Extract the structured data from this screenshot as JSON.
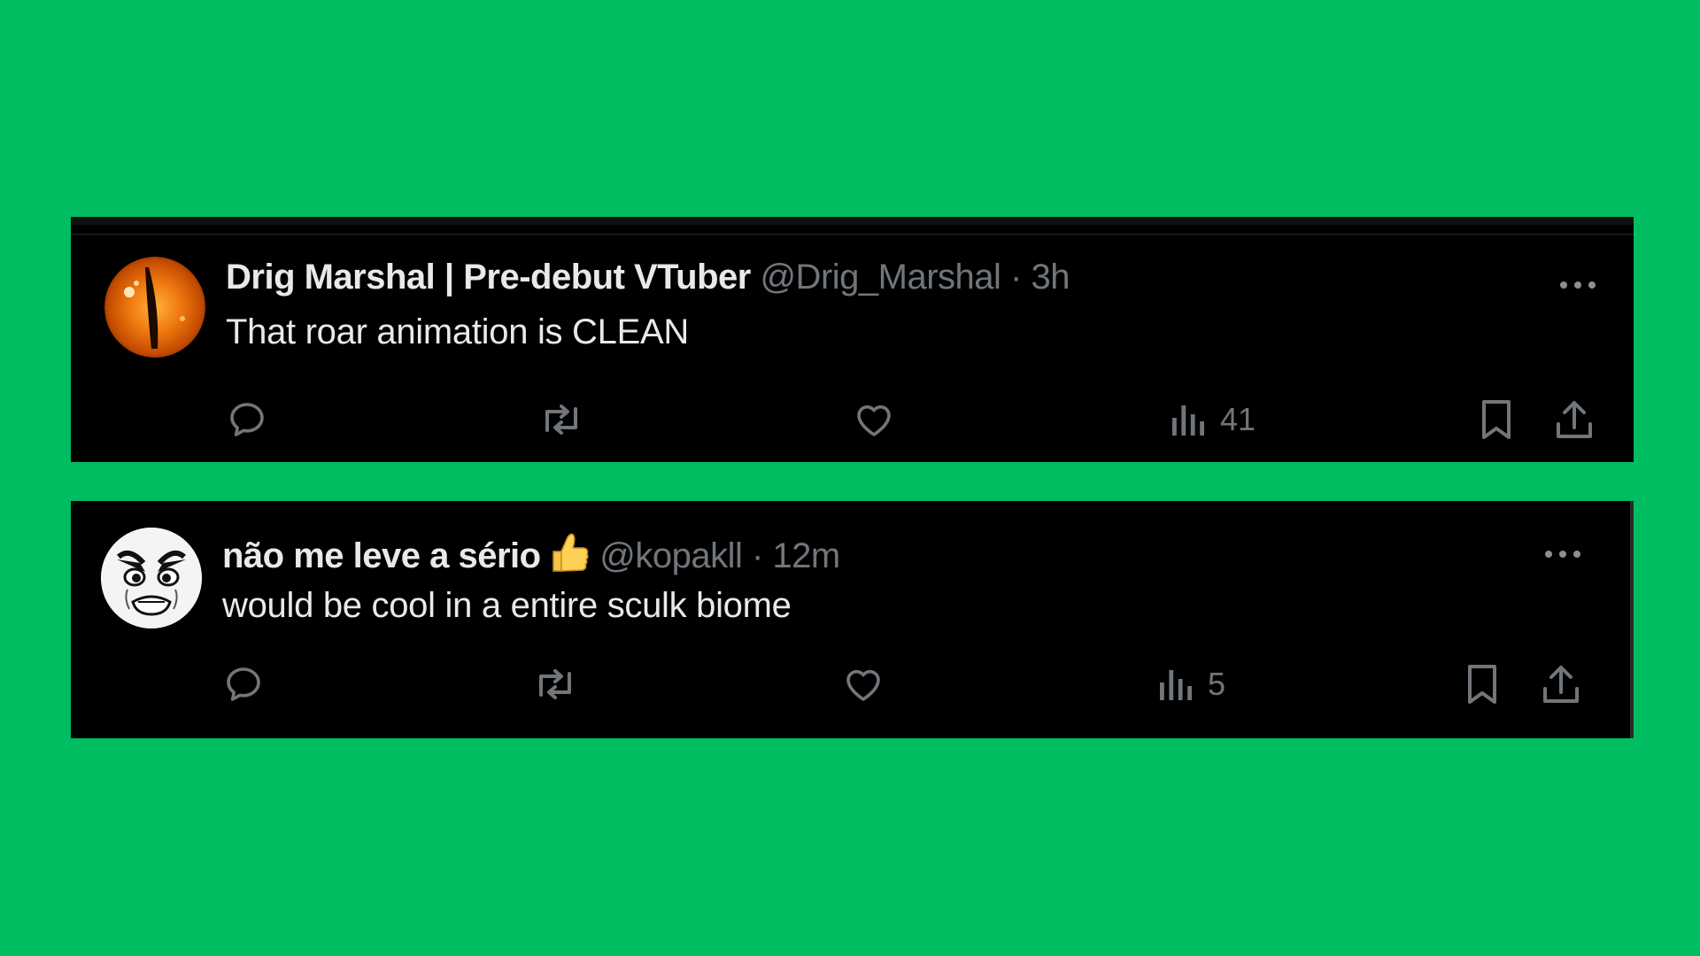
{
  "posts": [
    {
      "display_name": "Drig Marshal | Pre-debut VTuber",
      "handle": "@Drig_Marshal",
      "separator": "·",
      "time": "3h",
      "text": "That roar animation is CLEAN",
      "avatar_icon": "orange-dragon-eye",
      "views": "41"
    },
    {
      "display_name": "não me leve a sério",
      "name_emoji": "thumbs-up-emoji",
      "handle": "@kopakll",
      "separator": "·",
      "time": "12m",
      "text": "would be cool in a entire sculk biome",
      "avatar_icon": "angry-cartoon-face",
      "views": "5"
    }
  ],
  "colors": {
    "background": "#00bd62",
    "card": "#000000",
    "primary_text": "#e7e9ea",
    "secondary_text": "#71767b"
  }
}
